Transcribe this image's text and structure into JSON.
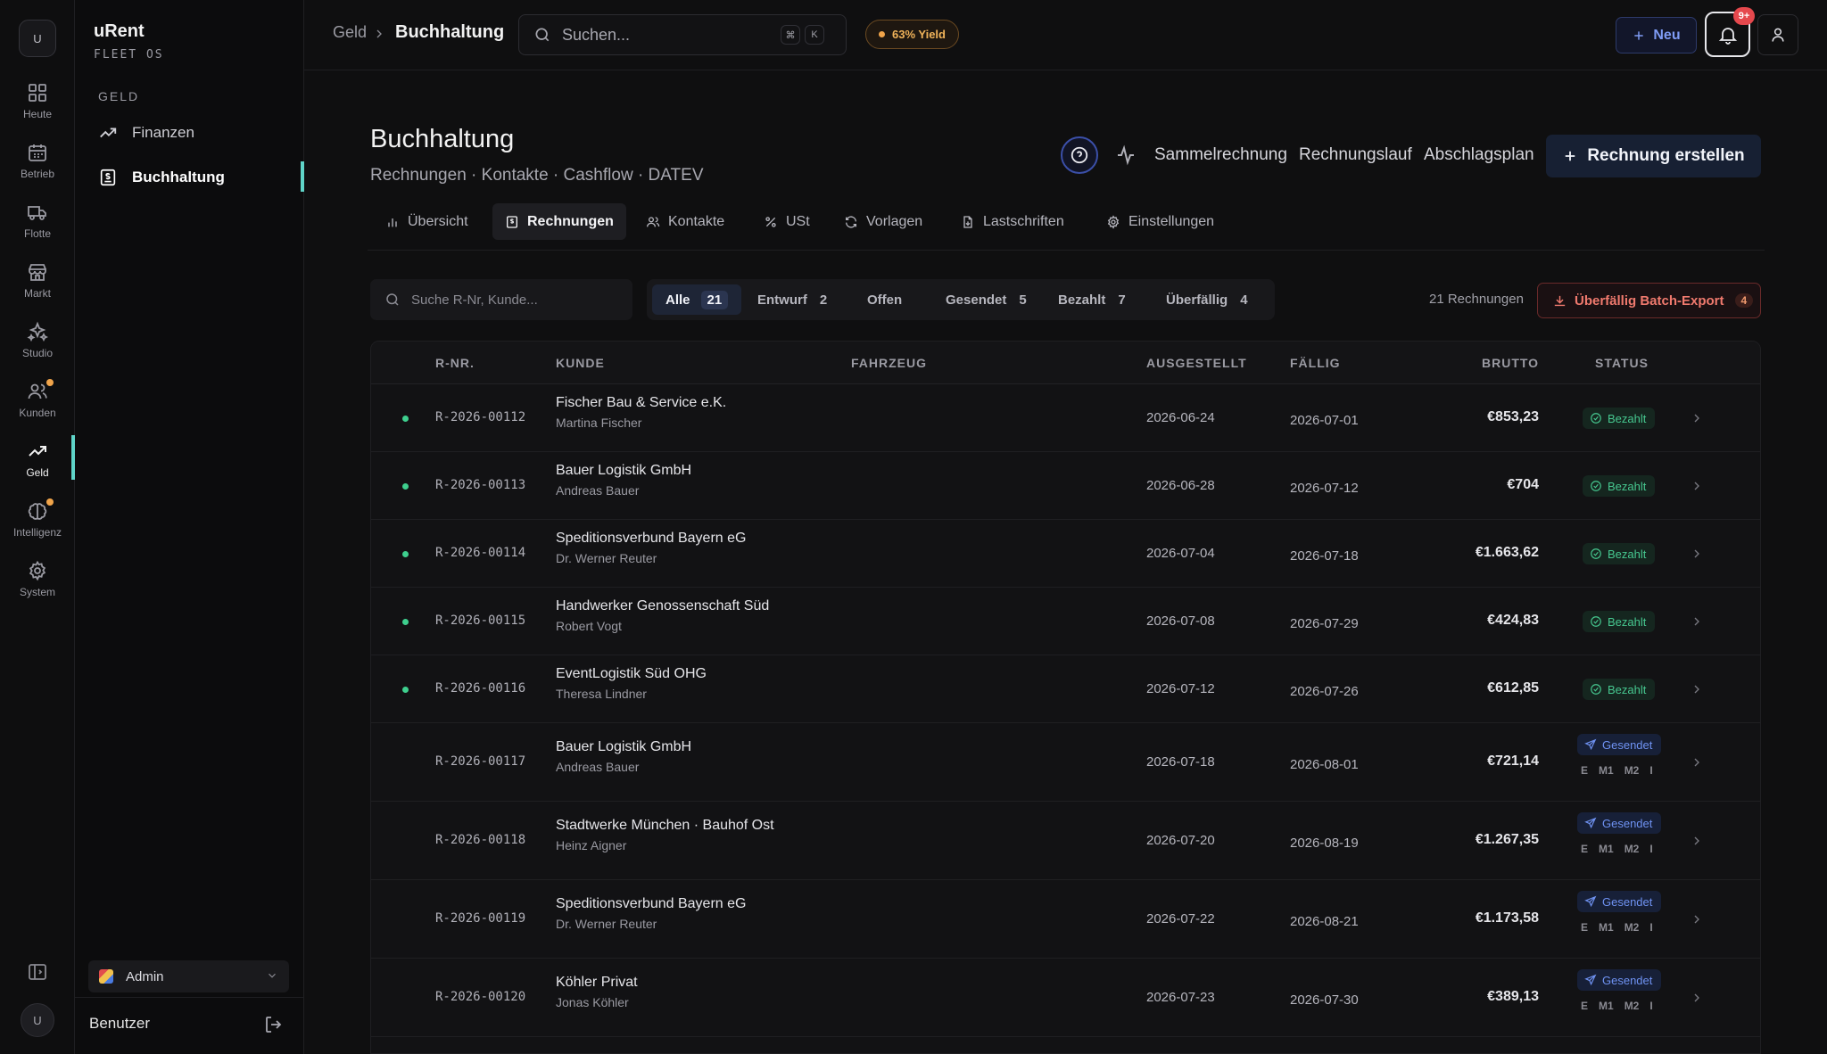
{
  "rail": {
    "logo": "U",
    "items": [
      {
        "label": "Heute",
        "icon": "dashboard-icon"
      },
      {
        "label": "Betrieb",
        "icon": "calendar-icon"
      },
      {
        "label": "Flotte",
        "icon": "truck-icon"
      },
      {
        "label": "Markt",
        "icon": "store-icon"
      },
      {
        "label": "Studio",
        "icon": "sparkles-icon"
      },
      {
        "label": "Kunden",
        "icon": "users-icon"
      },
      {
        "label": "Geld",
        "icon": "trending-up-icon"
      },
      {
        "label": "Intelligenz",
        "icon": "brain-icon"
      },
      {
        "label": "System",
        "icon": "gear-icon"
      }
    ],
    "avatar": "U"
  },
  "sidebar": {
    "brand": "uRent",
    "brand_sub": "FLEET OS",
    "section": "GELD",
    "items": [
      {
        "label": "Finanzen"
      },
      {
        "label": "Buchhaltung"
      }
    ],
    "role": "Admin",
    "user": "Benutzer"
  },
  "topbar": {
    "breadcrumb_parent": "Geld",
    "breadcrumb_current": "Buchhaltung",
    "search_placeholder": "Suchen...",
    "kbd1": "⌘",
    "kbd2": "K",
    "yield": "63% Yield",
    "new_button": "Neu",
    "notif_badge": "9+"
  },
  "page": {
    "title": "Buchhaltung",
    "subtitle": "Rechnungen · Kontakte · Cashflow · DATEV",
    "links": [
      "Sammelrechnung",
      "Rechnungslauf",
      "Abschlagsplan"
    ],
    "create_button": "Rechnung erstellen"
  },
  "tabs": [
    {
      "label": "Übersicht",
      "icon": "bar-chart-icon"
    },
    {
      "label": "Rechnungen",
      "icon": "invoice-icon"
    },
    {
      "label": "Kontakte",
      "icon": "contacts-icon"
    },
    {
      "label": "USt",
      "icon": "percent-icon"
    },
    {
      "label": "Vorlagen",
      "icon": "refresh-icon"
    },
    {
      "label": "Lastschriften",
      "icon": "file-icon"
    },
    {
      "label": "Einstellungen",
      "icon": "settings-icon"
    }
  ],
  "filters": {
    "search_placeholder": "Suche R-Nr, Kunde...",
    "chips": [
      {
        "label": "Alle",
        "count": "21"
      },
      {
        "label": "Entwurf",
        "count": "2"
      },
      {
        "label": "Offen",
        "count": ""
      },
      {
        "label": "Gesendet",
        "count": "5"
      },
      {
        "label": "Bezahlt",
        "count": "7"
      },
      {
        "label": "Überfällig",
        "count": "4"
      }
    ],
    "count_label": "21 Rechnungen",
    "export_button": "Überfällig Batch-Export",
    "export_count": "4"
  },
  "table": {
    "columns": {
      "rnr": "R-NR.",
      "kunde": "KUNDE",
      "fahrzeug": "FAHRZEUG",
      "ausgestellt": "AUSGESTELLT",
      "faellig": "FÄLLIG",
      "brutto": "BRUTTO",
      "status": "STATUS"
    },
    "status_colors": {
      "bezahlt": "#46c78f",
      "gesendet": "#6f92f2"
    },
    "steps": [
      "E",
      "M1",
      "M2",
      "I"
    ],
    "rows": [
      {
        "rnr": "R-2026-00112",
        "kunde": "Fischer Bau & Service e.K.",
        "person": "Martina Fischer",
        "ausgestellt": "2026-06-24",
        "faellig": "2026-07-01",
        "brutto": "€853,23",
        "status": "Bezahlt"
      },
      {
        "rnr": "R-2026-00113",
        "kunde": "Bauer Logistik GmbH",
        "person": "Andreas Bauer",
        "ausgestellt": "2026-06-28",
        "faellig": "2026-07-12",
        "brutto": "€704",
        "status": "Bezahlt"
      },
      {
        "rnr": "R-2026-00114",
        "kunde": "Speditionsverbund Bayern eG",
        "person": "Dr. Werner Reuter",
        "ausgestellt": "2026-07-04",
        "faellig": "2026-07-18",
        "brutto": "€1.663,62",
        "status": "Bezahlt"
      },
      {
        "rnr": "R-2026-00115",
        "kunde": "Handwerker Genossenschaft Süd",
        "person": "Robert Vogt",
        "ausgestellt": "2026-07-08",
        "faellig": "2026-07-29",
        "brutto": "€424,83",
        "status": "Bezahlt"
      },
      {
        "rnr": "R-2026-00116",
        "kunde": "EventLogistik Süd OHG",
        "person": "Theresa Lindner",
        "ausgestellt": "2026-07-12",
        "faellig": "2026-07-26",
        "brutto": "€612,85",
        "status": "Bezahlt"
      },
      {
        "rnr": "R-2026-00117",
        "kunde": "Bauer Logistik GmbH",
        "person": "Andreas Bauer",
        "ausgestellt": "2026-07-18",
        "faellig": "2026-08-01",
        "brutto": "€721,14",
        "status": "Gesendet"
      },
      {
        "rnr": "R-2026-00118",
        "kunde": "Stadtwerke München · Bauhof Ost",
        "person": "Heinz Aigner",
        "ausgestellt": "2026-07-20",
        "faellig": "2026-08-19",
        "brutto": "€1.267,35",
        "status": "Gesendet"
      },
      {
        "rnr": "R-2026-00119",
        "kunde": "Speditionsverbund Bayern eG",
        "person": "Dr. Werner Reuter",
        "ausgestellt": "2026-07-22",
        "faellig": "2026-08-21",
        "brutto": "€1.173,58",
        "status": "Gesendet"
      },
      {
        "rnr": "R-2026-00120",
        "kunde": "Köhler Privat",
        "person": "Jonas Köhler",
        "ausgestellt": "2026-07-23",
        "faellig": "2026-07-30",
        "brutto": "€389,13",
        "status": "Gesendet"
      }
    ]
  }
}
